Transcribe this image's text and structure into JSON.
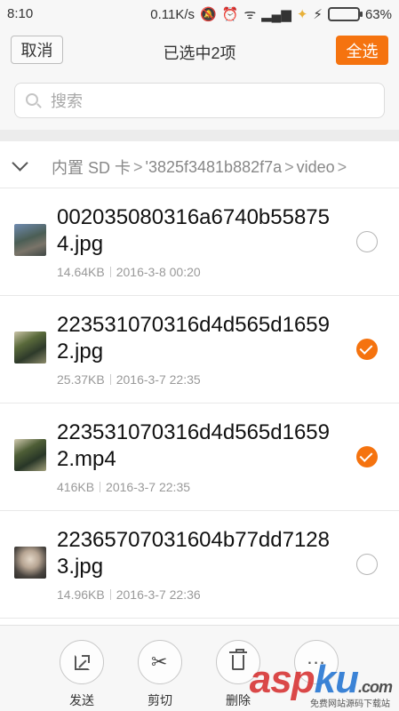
{
  "status_bar": {
    "time": "8:10",
    "speed": "0.11K/s",
    "battery_pct": "63%",
    "battery_level": 0.63,
    "icons": [
      "mute-icon",
      "alarm-icon",
      "wifi-icon",
      "signal-icon",
      "data-icon",
      "charging-icon",
      "battery-icon"
    ]
  },
  "top_bar": {
    "cancel_label": "取消",
    "title": "已选中2项",
    "select_all_label": "全选"
  },
  "search": {
    "placeholder": "搜索"
  },
  "breadcrumb": {
    "items": [
      "内置 SD 卡",
      "'3825f3481b882f7a",
      "video"
    ],
    "separator": ">"
  },
  "files": [
    {
      "name": "002035080316a6740b558754.jpg",
      "size": "14.64KB",
      "date": "2016-3-8 00:20",
      "checked": false
    },
    {
      "name": "223531070316d4d565d16592.jpg",
      "size": "25.37KB",
      "date": "2016-3-7 22:35",
      "checked": true
    },
    {
      "name": "223531070316d4d565d16592.mp4",
      "size": "416KB",
      "date": "2016-3-7 22:35",
      "checked": true
    },
    {
      "name": "22365707031604b77dd71283.jpg",
      "size": "14.96KB",
      "date": "2016-3-7 22:36",
      "checked": false
    }
  ],
  "toolbar": {
    "send_label": "发送",
    "cut_label": "剪切",
    "delete_label": "删除",
    "more_label": "..."
  },
  "watermark": {
    "brand_a": "asp",
    "brand_b": "ku",
    "brand_c": ".com",
    "tagline": "免费网站源码下载站"
  },
  "colors": {
    "accent": "#f5730f",
    "bar_bg": "#f7f7f7"
  }
}
